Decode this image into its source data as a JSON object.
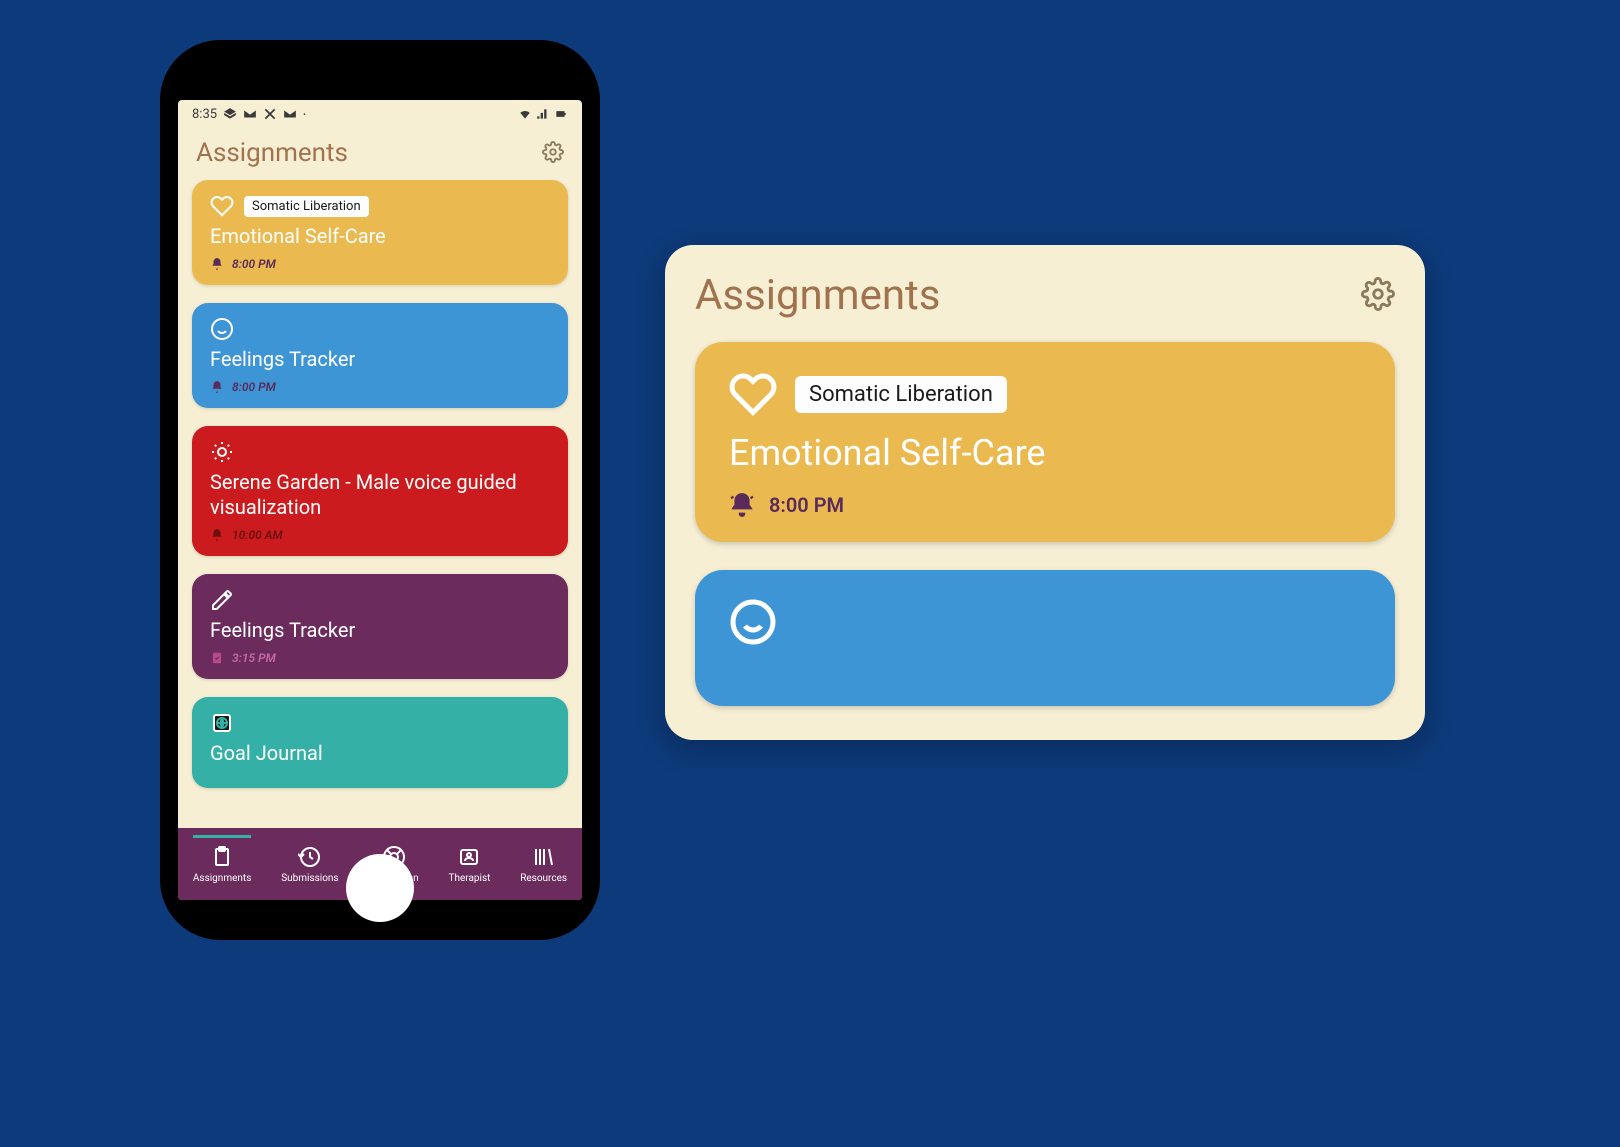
{
  "status_bar": {
    "time": "8:35",
    "icons": [
      "chat",
      "gmail",
      "x",
      "gmail",
      "dot"
    ]
  },
  "header": {
    "title": "Assignments"
  },
  "cards": [
    {
      "color": "yellow",
      "icon": "heart",
      "tag": "Somatic Liberation",
      "title": "Emotional Self-Care",
      "time_icon": "bell-ring",
      "time": "8:00 PM"
    },
    {
      "color": "blue",
      "icon": "smile",
      "tag": null,
      "title": "Feelings Tracker",
      "time_icon": "bell-ring",
      "time": "8:00 PM"
    },
    {
      "color": "red",
      "icon": "sun-gear",
      "tag": null,
      "title": "Serene Garden - Male voice guided visualization",
      "time_icon": "bell",
      "time": "10:00 AM"
    },
    {
      "color": "purple",
      "icon": "pencil",
      "tag": null,
      "title": "Feelings Tracker",
      "time_icon": "check-clipboard",
      "time": "3:15 PM"
    },
    {
      "color": "teal",
      "icon": "globe-box",
      "tag": null,
      "title": "Goal Journal",
      "time_icon": null,
      "time": ""
    }
  ],
  "nav": [
    {
      "label": "Assignments",
      "icon": "clipboard",
      "active": true
    },
    {
      "label": "Submissions",
      "icon": "history",
      "active": false
    },
    {
      "label": "Safety Plan",
      "icon": "lifebuoy",
      "active": false
    },
    {
      "label": "Therapist",
      "icon": "id-card",
      "active": false
    },
    {
      "label": "Resources",
      "icon": "books",
      "active": false
    }
  ],
  "zoom": {
    "title": "Assignments",
    "card1": {
      "tag": "Somatic Liberation",
      "title": "Emotional Self-Care",
      "time": "8:00 PM"
    }
  }
}
